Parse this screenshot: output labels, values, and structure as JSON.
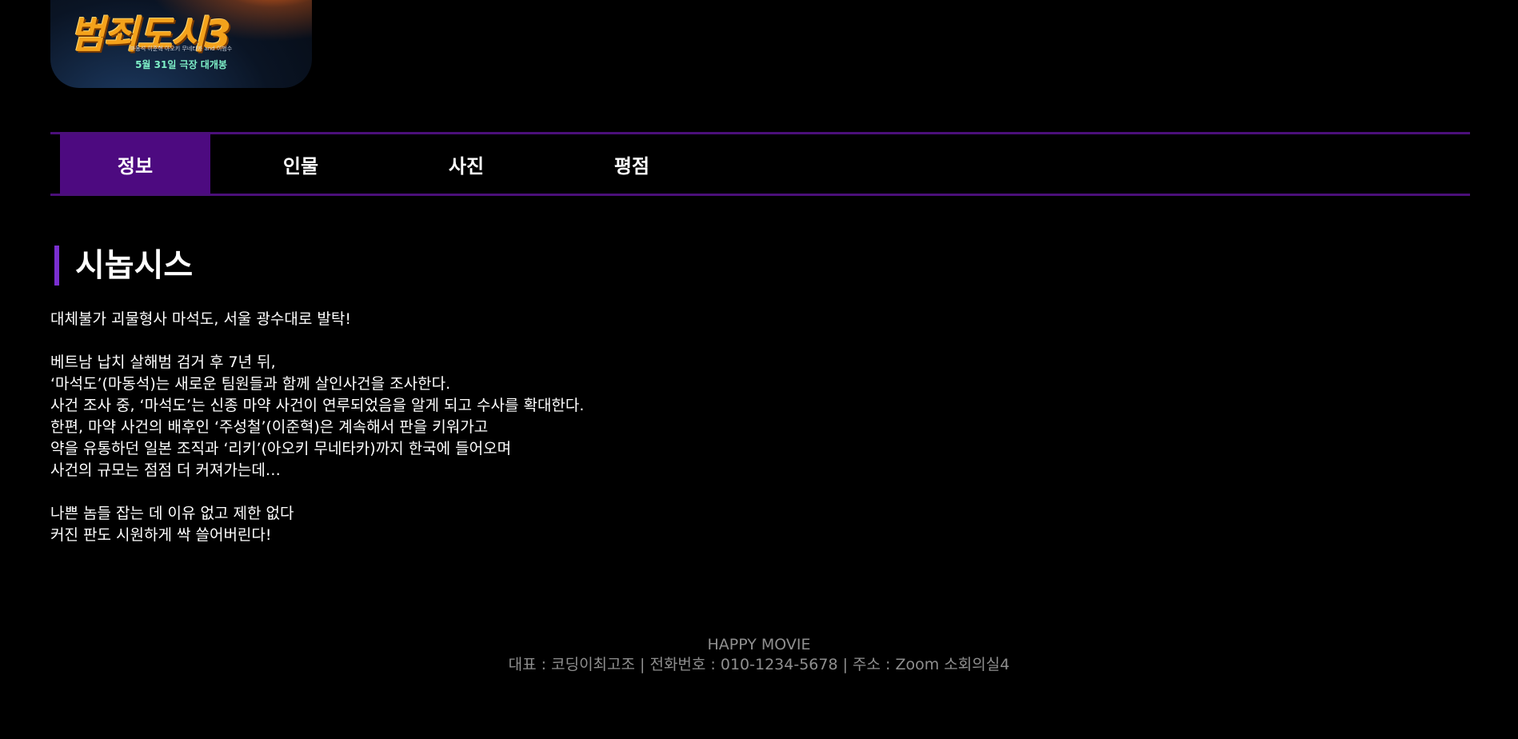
{
  "poster": {
    "title": "범죄도시3",
    "credits": "마동석  이준혁  아오키 무네타카  and 이범수",
    "release": "5월 31일 극장 대개봉"
  },
  "tabs": [
    {
      "label": "정보",
      "active": true
    },
    {
      "label": "인물",
      "active": false
    },
    {
      "label": "사진",
      "active": false
    },
    {
      "label": "평점",
      "active": false
    }
  ],
  "synopsis": {
    "heading": "시놉시스",
    "lines": [
      "대체불가 괴물형사 마석도, 서울 광수대로 발탁!",
      "",
      "베트남 납치 살해범 검거 후 7년 뒤,",
      "‘마석도’(마동석)는 새로운 팀원들과 함께 살인사건을 조사한다.",
      "사건 조사 중, ‘마석도’는 신종 마약 사건이 연루되었음을 알게 되고 수사를 확대한다.",
      "한편, 마약 사건의 배후인 ‘주성철’(이준혁)은 계속해서 판을 키워가고",
      "약을 유통하던 일본 조직과 ‘리키’(아오키 무네타카)까지 한국에 들어오며",
      "사건의 규모는 점점 더 커져가는데…",
      "",
      "나쁜 놈들 잡는 데 이유 없고 제한 없다",
      "커진 판도 시원하게 싹 쓸어버린다!"
    ]
  },
  "footer": {
    "brand": "HAPPY MOVIE",
    "info": "대표 : 코딩이최고조 | 전화번호 : 010-1234-5678 | 주소 : Zoom 소회의실4"
  }
}
